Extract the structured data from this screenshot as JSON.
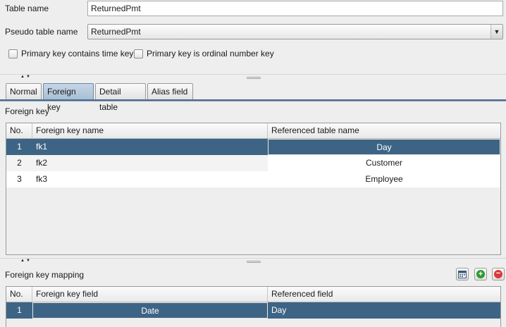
{
  "form": {
    "table_name_label": "Table name",
    "table_name_value": "ReturnedPmt",
    "pseudo_label": "Pseudo table name",
    "pseudo_value": "ReturnedPmt",
    "chk_time_label": "Primary key contains time key",
    "chk_ordinal_label": "Primary key is ordinal number key"
  },
  "splitter_arrows": "▲▼",
  "tabs": [
    {
      "label": "Normal"
    },
    {
      "label": "Foreign key"
    },
    {
      "label": "Detail table"
    },
    {
      "label": "Alias field"
    }
  ],
  "foreign_key": {
    "section_label": "Foreign key",
    "headers": [
      "No.",
      "Foreign key name",
      "Referenced table name"
    ],
    "rows": [
      {
        "no": "1",
        "name": "fk1",
        "ref": "Day"
      },
      {
        "no": "2",
        "name": "fk2",
        "ref": "Customer"
      },
      {
        "no": "3",
        "name": "fk3",
        "ref": "Employee"
      }
    ]
  },
  "mapping": {
    "section_label": "Foreign key mapping",
    "headers": [
      "No.",
      "Foreign key field",
      "Referenced field"
    ],
    "rows": [
      {
        "no": "1",
        "field": "Date",
        "ref": "Day"
      }
    ]
  },
  "icons": {
    "calendar": "calendar-icon",
    "add": "add-icon",
    "remove": "remove-icon"
  },
  "colors": {
    "selection": "#3d6485",
    "tab_active": "#b6cadd"
  }
}
